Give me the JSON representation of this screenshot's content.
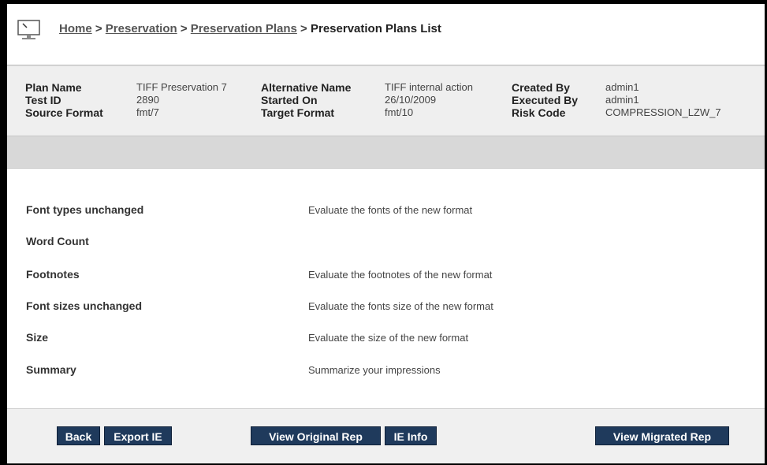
{
  "breadcrumb": {
    "home": "Home",
    "sep1": ">",
    "preservation": "Preservation",
    "sep2": ">",
    "plans": "Preservation Plans",
    "sep3": ">",
    "current": "Preservation Plans List"
  },
  "plan_info": {
    "plan_name_label": "Plan Name",
    "plan_name": "TIFF Preservation 7",
    "test_id_label": "Test ID",
    "test_id": "2890",
    "source_format_label": "Source Format",
    "source_format": "fmt/7",
    "alternative_name_label": "Alternative Name",
    "alternative_name": "TIFF internal action",
    "started_on_label": "Started On",
    "started_on": "26/10/2009",
    "target_format_label": "Target Format",
    "target_format": "fmt/10",
    "created_by_label": "Created By",
    "created_by": "admin1",
    "executed_by_label": "Executed By",
    "executed_by": "admin1",
    "risk_code_label": "Risk Code",
    "risk_code": "COMPRESSION_LZW_7"
  },
  "criteria": [
    {
      "label": "Font types unchanged",
      "description": "Evaluate the fonts of the new format"
    },
    {
      "label": "Word Count",
      "description": ""
    },
    {
      "label": "Footnotes",
      "description": "Evaluate the footnotes of the new format"
    },
    {
      "label": "Font sizes unchanged",
      "description": "Evaluate the fonts size of the new format"
    },
    {
      "label": "Size",
      "description": "Evaluate the size of the new format"
    },
    {
      "label": "Summary",
      "description": "Summarize your impressions"
    }
  ],
  "buttons": {
    "back": "Back",
    "export_ie": "Export IE",
    "view_original_rep": "View Original Rep",
    "ie_info": "IE Info",
    "view_migrated_rep": "View Migrated Rep"
  },
  "icons": {
    "header": "monitor-icon"
  },
  "colors": {
    "button_bg": "#1f3a5c",
    "info_bg": "#efefef",
    "band_bg": "#d8d8d8"
  }
}
